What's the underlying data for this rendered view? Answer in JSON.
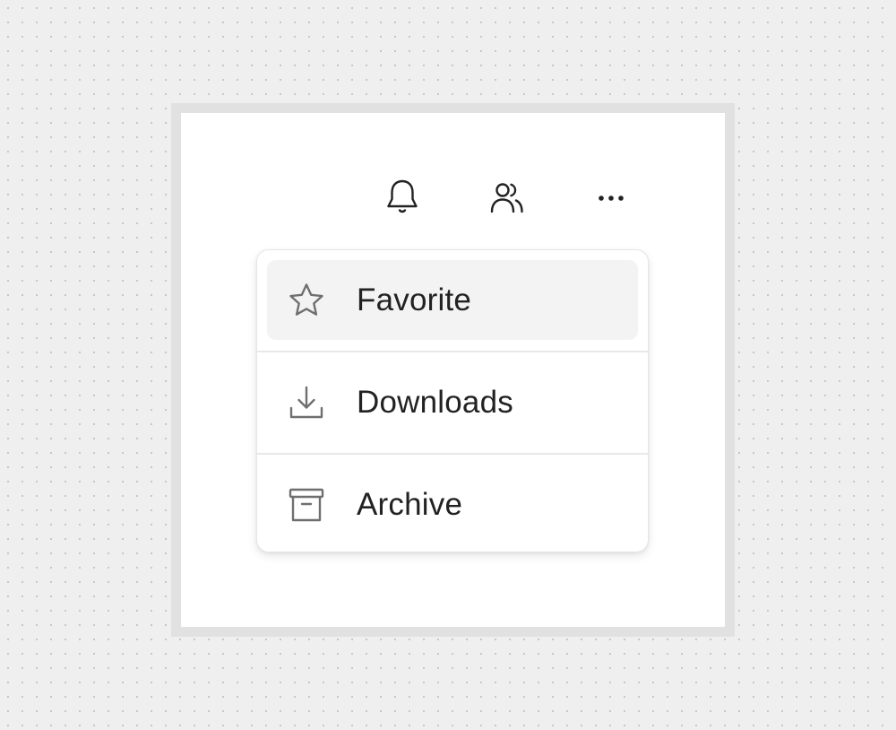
{
  "toolbar": {
    "buttons": [
      {
        "name": "notifications",
        "icon": "bell-icon"
      },
      {
        "name": "people",
        "icon": "users-icon"
      },
      {
        "name": "more",
        "icon": "ellipsis-icon"
      }
    ]
  },
  "menu": {
    "items": [
      {
        "label": "Favorite",
        "icon": "star-icon",
        "highlighted": true
      },
      {
        "label": "Downloads",
        "icon": "download-icon",
        "highlighted": false
      },
      {
        "label": "Archive",
        "icon": "archive-icon",
        "highlighted": false
      }
    ]
  },
  "colors": {
    "icon_dark": "#222222",
    "icon_muted": "#6f6f6f",
    "highlight": "#f3f3f3",
    "text": "#222222"
  }
}
